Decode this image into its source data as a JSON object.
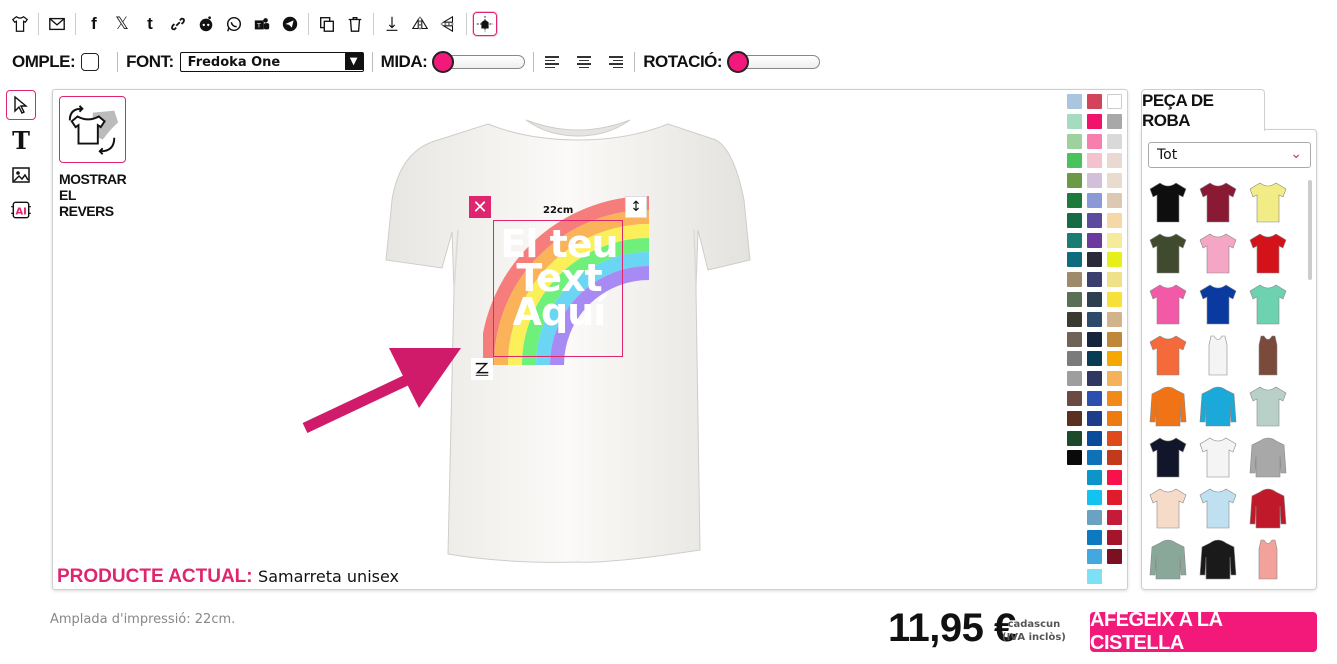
{
  "toolbar": {
    "icons": [
      "tshirt-icon",
      "mail-icon",
      "facebook-icon",
      "x-icon",
      "tumblr-icon",
      "link-icon",
      "reddit-icon",
      "whatsapp-icon",
      "teams-icon",
      "telegram-icon",
      "copy-icon",
      "trash-icon",
      "align-bottom-icon",
      "flip-horizontal-icon",
      "flip-vertical-icon",
      "center-icon"
    ]
  },
  "options": {
    "fill_label": "OMPLE:",
    "font_label": "FONT:",
    "font_value": "Fredoka One",
    "size_label": "MIDA:",
    "size_value": 0,
    "rotation_label": "ROTACIÓ:",
    "rotation_value": 0
  },
  "left_tools": [
    "select-icon",
    "text-icon",
    "image-icon",
    "ai-icon"
  ],
  "canvas": {
    "show_reverse_label": "MOSTRAR EL REVERS",
    "show_reverse_line1": "MOSTRAR",
    "show_reverse_line2": "EL REVERS",
    "design_text_line1": "El teu",
    "design_text_line2": "Text",
    "design_text_line3": "Aquí",
    "dimension": "22cm",
    "current_product_label": "PRODUCTE ACTUAL:",
    "current_product_value": "Samarreta unisex"
  },
  "palette": {
    "col1": [
      "#a9c6de",
      "#a5dcc0",
      "#9fd19e",
      "#48c45a",
      "#6a9a46",
      "#1e7a3a",
      "#156b45",
      "#1a7d73",
      "#0f6c7e",
      "#a08a6c",
      "#5a7055",
      "#3a3a30",
      "#6f6257",
      "#7b7b7b",
      "#9e9e9e",
      "#6c4a44",
      "#5b3020",
      "#1c4a2b",
      "#0a0a0a"
    ],
    "col2": [
      "#d3435a",
      "#f0126b",
      "#f77fae",
      "#f4c1cf",
      "#d2c0da",
      "#8a9ad6",
      "#5b4a9e",
      "#6a3a9e",
      "#2a2a3a",
      "#3b3f6e",
      "#2e3f4f",
      "#2c4b6a",
      "#17253a",
      "#0a3b55",
      "#2f3860",
      "#2d4fb0",
      "#1d3c8a",
      "#0a4c9c",
      "#0e72b8",
      "#0b95c9",
      "#11c3f0",
      "#6aa3c2",
      "#0c7ac0",
      "#44a8e0",
      "#7ee0f5"
    ],
    "col3": [
      "#ffffff",
      "#a8a8a8",
      "#d9d9d9",
      "#e8d9d2",
      "#e8dccd",
      "#ddc8b2",
      "#f6d8a8",
      "#f4ec9a",
      "#e6ef1a",
      "#efe08a",
      "#f7e03a",
      "#d2b48c",
      "#c0863a",
      "#f5a800",
      "#f6b25a",
      "#f28a1a",
      "#ee7a12",
      "#e04a1a",
      "#c23a1a",
      "#f7124a",
      "#e01c2a",
      "#c61a3a",
      "#a4142a",
      "#7a1020"
    ]
  },
  "panel": {
    "tab_label": "PEÇA DE ROBA",
    "filter_value": "Tot",
    "garments": [
      {
        "name": "tshirt-black",
        "color": "#0e0e0e"
      },
      {
        "name": "tshirt-burgundy",
        "color": "#8a1a34"
      },
      {
        "name": "tshirt-yellow",
        "color": "#f2ec86"
      },
      {
        "name": "tshirt-olive",
        "color": "#3f4a2e"
      },
      {
        "name": "tshirt-pink",
        "color": "#f5a6c4"
      },
      {
        "name": "tshirt-red",
        "color": "#d4121a"
      },
      {
        "name": "tshirt-fuchsia",
        "color": "#f25aa8"
      },
      {
        "name": "tshirt-blue",
        "color": "#0a3aa0"
      },
      {
        "name": "tshirt-mint",
        "color": "#6ed2b0"
      },
      {
        "name": "tshirt-orange",
        "color": "#f46a3a"
      },
      {
        "name": "tanktop-white",
        "color": "#f4f4f4"
      },
      {
        "name": "tanktop-brown",
        "color": "#7a4a3a"
      },
      {
        "name": "hoodie-orange",
        "color": "#f07416"
      },
      {
        "name": "hoodie-cyan",
        "color": "#1aa9d8"
      },
      {
        "name": "tshirt-tiedye",
        "color": "#b8d0c8"
      },
      {
        "name": "tshirt-navy",
        "color": "#12162a"
      },
      {
        "name": "raglan-black-white",
        "color": "#f4f4f4"
      },
      {
        "name": "hoodie-grey",
        "color": "#a8a8a8"
      },
      {
        "name": "tshirt-peach",
        "color": "#f6dcc8"
      },
      {
        "name": "tshirt-lightblue",
        "color": "#bfe0f0"
      },
      {
        "name": "jacket-red",
        "color": "#c01a2a"
      },
      {
        "name": "sweatshirt-sage",
        "color": "#8aa89a"
      },
      {
        "name": "hoodie-black-orange",
        "color": "#1a1a1a"
      },
      {
        "name": "tanktop-coral",
        "color": "#f2a29a"
      }
    ]
  },
  "footer": {
    "print_width": "Amplada d'impressió: 22cm.",
    "price": "11,95 €",
    "price_note_line1": "cadascun",
    "price_note_line2": "(IVA inclòs)",
    "add_to_cart": "AFEGEIX A LA CISTELLA"
  },
  "colors": {
    "accent": "#f2197a",
    "accent_dark": "#e0256f"
  }
}
